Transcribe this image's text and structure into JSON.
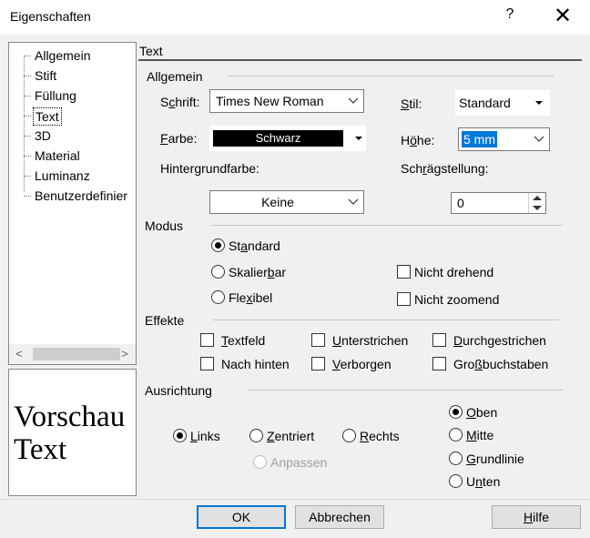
{
  "window": {
    "title": "Eigenschaften",
    "help_icon": "?",
    "close_icon": "✕"
  },
  "tree": {
    "items": [
      {
        "label": "Allgemein"
      },
      {
        "label": "Stift"
      },
      {
        "label": "Füllung"
      },
      {
        "label": "Text",
        "selected": true
      },
      {
        "label": "3D"
      },
      {
        "label": "Material"
      },
      {
        "label": "Luminanz"
      },
      {
        "label": "Benutzerdefinier"
      }
    ]
  },
  "preview": {
    "text": "Vorschau\nText"
  },
  "panel": {
    "title": "Text"
  },
  "allgemein": {
    "label": "Allgemein",
    "schrift_label": "Schrift:",
    "schrift_value": "Times New Roman",
    "stil_label": "Stil:",
    "stil_value": "Standard",
    "farbe_label": "Farbe:",
    "farbe_value": "Schwarz",
    "hoehe_label": "Höhe:",
    "hoehe_value": "5 mm",
    "hintergrund_label": "Hintergrundfarbe:",
    "hintergrund_value": "Keine",
    "schraeg_label": "Schrägstellung:",
    "schraeg_value": "0"
  },
  "modus": {
    "label": "Modus",
    "standard": "Standard",
    "skalierbar": "Skalierbar",
    "flexibel": "Flexibel",
    "selected": "Standard",
    "nicht_drehend": "Nicht drehend",
    "nicht_zoomend": "Nicht zoomend"
  },
  "effekte": {
    "label": "Effekte",
    "textfeld": "Textfeld",
    "unterstrichen": "Unterstrichen",
    "durchgestrichen": "Durchgestrichen",
    "nach_hinten": "Nach hinten",
    "verborgen": "Verborgen",
    "grossbuchstaben": "Großbuchstaben"
  },
  "ausrichtung": {
    "label": "Ausrichtung",
    "links": "Links",
    "zentriert": "Zentriert",
    "rechts": "Rechts",
    "anpassen": "Anpassen",
    "oben": "Oben",
    "mitte": "Mitte",
    "grundlinie": "Grundlinie",
    "unten": "Unten",
    "horizontal_selected": "Links",
    "vertical_selected": "Oben"
  },
  "buttons": {
    "ok": "OK",
    "abbrechen": "Abbrechen",
    "hilfe": "Hilfe"
  },
  "colors": {
    "accent": "#0078d7",
    "swatch": "#000000",
    "window": "#f0f0f0"
  }
}
